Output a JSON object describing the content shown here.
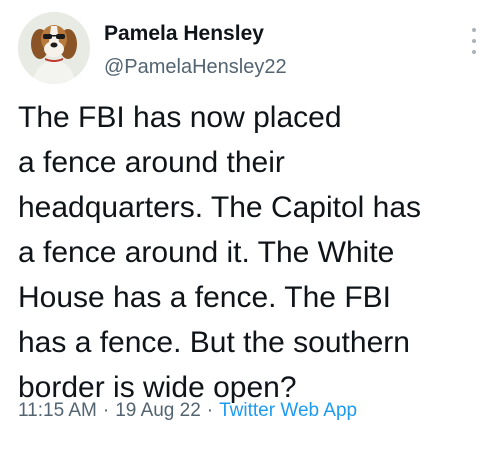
{
  "tweet": {
    "author_name": "Pamela Hensley",
    "author_handle": "@PamelaHensley22",
    "avatar_icon": "beagle-dog-avatar",
    "more_icon": "more-vertical-icon",
    "text_lines": [
      "The FBI has now placed",
      "a fence around their",
      "headquarters. The Capitol has",
      "a fence around it. The White",
      "House has a fence. The FBI",
      "has a fence. But the southern",
      "border is wide open?"
    ],
    "time": "11:15 AM",
    "separator": "·",
    "date": "19 Aug 22",
    "source_app": "Twitter Web App"
  },
  "colors": {
    "text": "#0f1419",
    "secondary": "#536471",
    "link": "#1d9bf0"
  }
}
